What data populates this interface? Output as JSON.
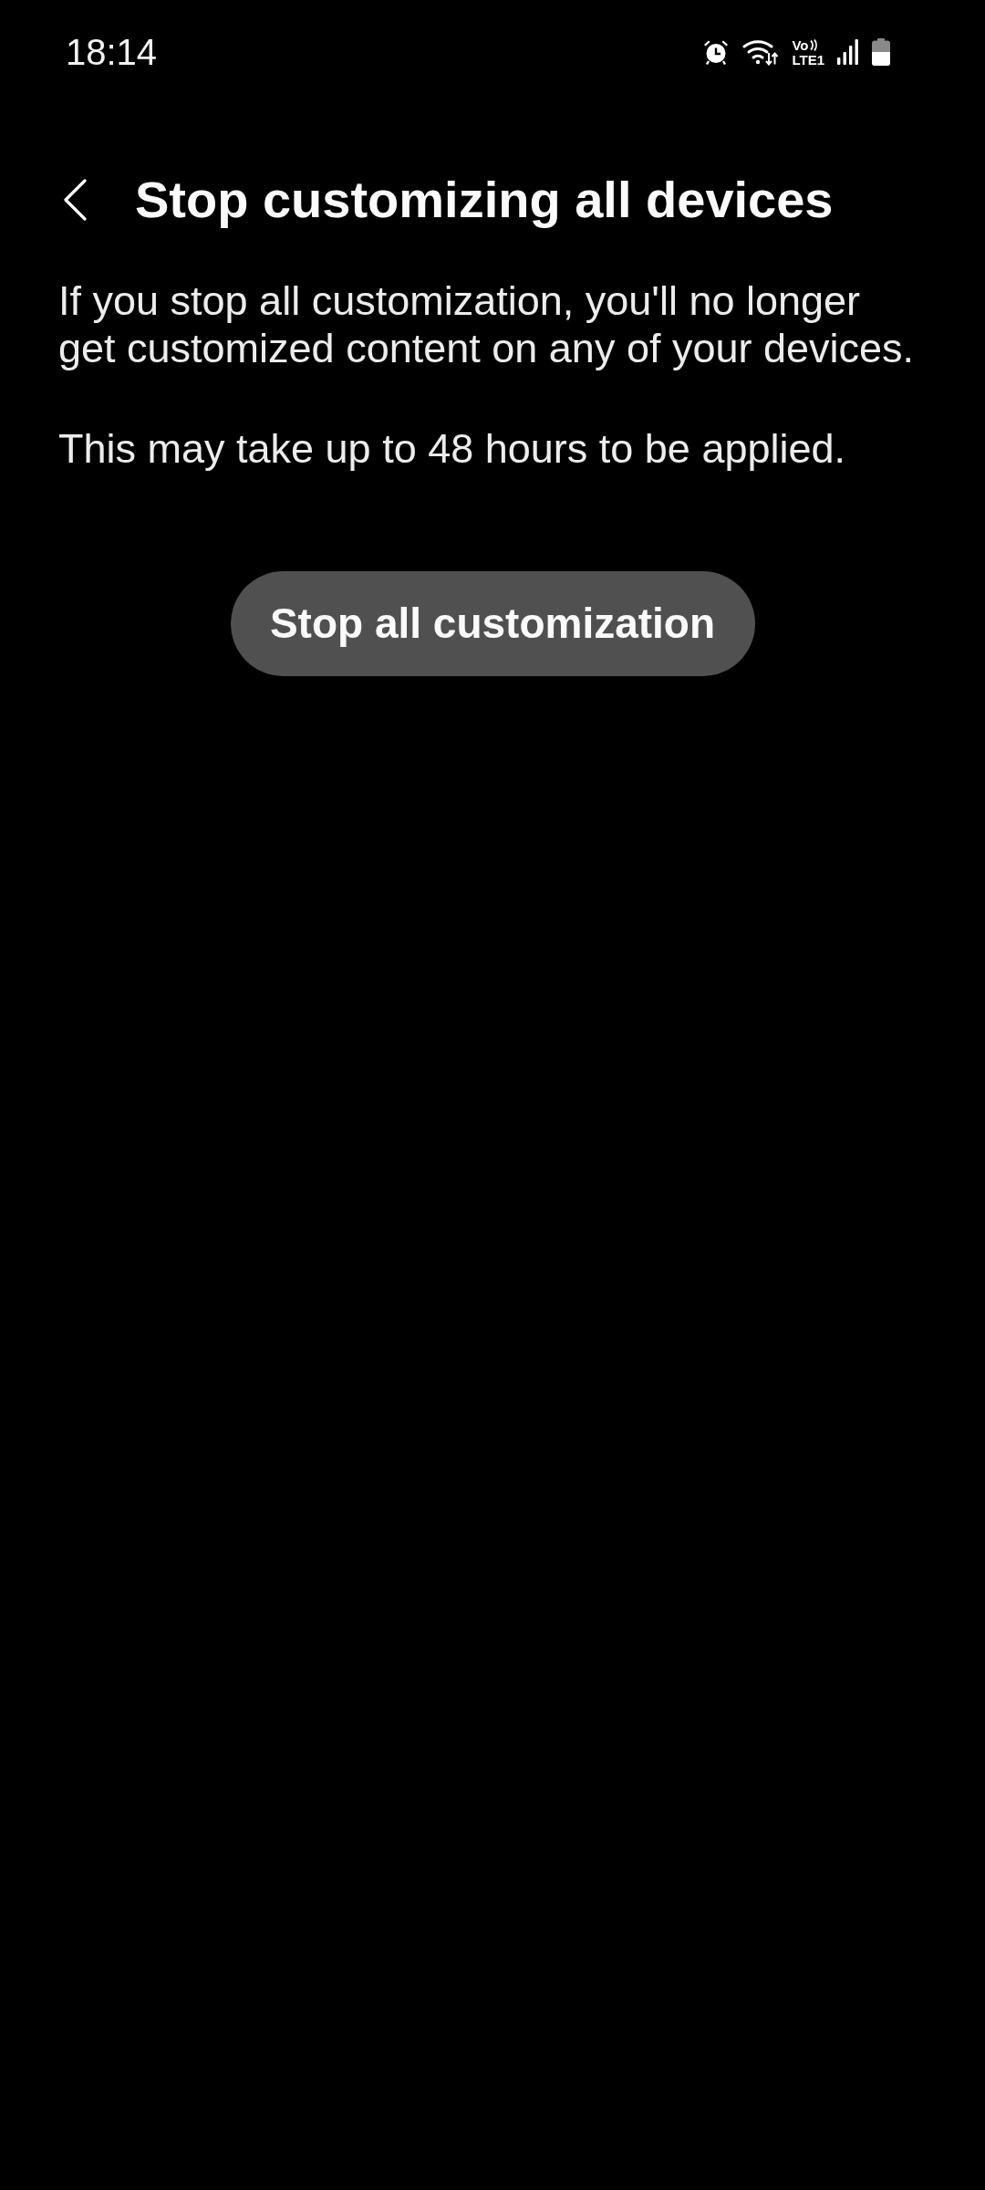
{
  "status_bar": {
    "time": "18:14",
    "volte": {
      "line_1": "Vo",
      "line_2": "LTE1"
    }
  },
  "header": {
    "title": "Stop customizing all devices"
  },
  "paragraphs": [
    "If you stop all customization, you'll no longer get customized content on any of your devices.",
    "This may take up to 48 hours to be applied."
  ],
  "buttons": [
    "Stop all customization"
  ]
}
